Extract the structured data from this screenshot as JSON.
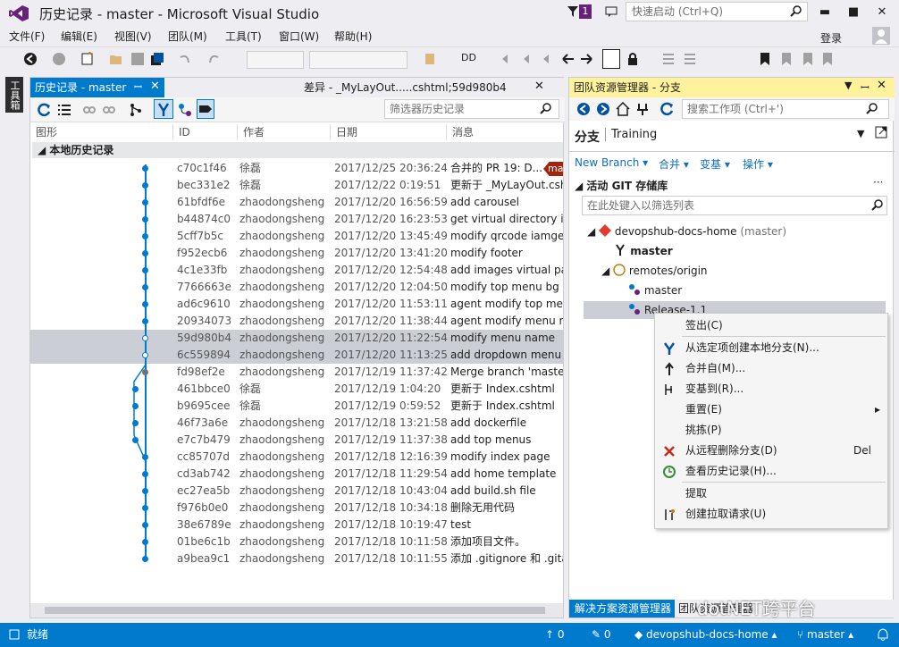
{
  "window": {
    "title": "历史记录 - master - Microsoft Visual Studio",
    "quick_launch": "快速启动 (Ctrl+Q)",
    "notif_count": "1",
    "login": "登录"
  },
  "menu": [
    "文件(F)",
    "编辑(E)",
    "视图(V)",
    "团队(M)",
    "工具(T)",
    "窗口(W)",
    "帮助(H)"
  ],
  "left_tab": "工具箱",
  "history": {
    "tab_label": "历史记录 - master",
    "diff_tab": "差异 - _MyLayOut.....cshtml;59d980b4",
    "filter_placeholder": "筛选器历史记录",
    "columns": [
      "图形",
      "ID",
      "作者",
      "日期",
      "消息"
    ],
    "group": "本地历史记录",
    "tag": "ma",
    "rows": [
      {
        "id": "c70c1f46",
        "author": "徐磊",
        "date": "2017/12/25 20:36:24",
        "msg": "合并的 PR 19: D..."
      },
      {
        "id": "bec331e2",
        "author": "徐磊",
        "date": "2017/12/22 0:19:51",
        "msg": "更新于 _MyLayOut.cshtml"
      },
      {
        "id": "61bfdf6e",
        "author": "zhaodongsheng",
        "date": "2017/12/20 16:56:59",
        "msg": "add carousel"
      },
      {
        "id": "b44874c0",
        "author": "zhaodongsheng",
        "date": "2017/12/20 16:23:53",
        "msg": "get virtual directory in"
      },
      {
        "id": "5cff7b5c",
        "author": "zhaodongsheng",
        "date": "2017/12/20 13:45:49",
        "msg": "modify qrcode iamge"
      },
      {
        "id": "f952ecb6",
        "author": "zhaodongsheng",
        "date": "2017/12/20 13:41:20",
        "msg": "modify footer"
      },
      {
        "id": "4c1e33fb",
        "author": "zhaodongsheng",
        "date": "2017/12/20 12:54:48",
        "msg": "add images virtual pa"
      },
      {
        "id": "7766663e",
        "author": "zhaodongsheng",
        "date": "2017/12/20 12:04:50",
        "msg": "modify top menu bg"
      },
      {
        "id": "ad6c9610",
        "author": "zhaodongsheng",
        "date": "2017/12/20 11:53:11",
        "msg": "agent modify top men"
      },
      {
        "id": "20934073",
        "author": "zhaodongsheng",
        "date": "2017/12/20 11:38:44",
        "msg": "agent modify menu n"
      },
      {
        "id": "59d980b4",
        "author": "zhaodongsheng",
        "date": "2017/12/20 11:22:54",
        "msg": "modify menu name"
      },
      {
        "id": "6c559894",
        "author": "zhaodongsheng",
        "date": "2017/12/20 11:13:25",
        "msg": "add dropdown menu"
      },
      {
        "id": "fd98ef2e",
        "author": "zhaodongsheng",
        "date": "2017/12/19 11:37:42",
        "msg": "Merge branch 'maste"
      },
      {
        "id": "461bbce0",
        "author": "徐磊",
        "date": "2017/12/19 1:04:20",
        "msg": "更新于 Index.cshtml"
      },
      {
        "id": "b9695cee",
        "author": "徐磊",
        "date": "2017/12/19 0:59:52",
        "msg": "更新于 Index.cshtml"
      },
      {
        "id": "46f73a6e",
        "author": "zhaodongsheng",
        "date": "2017/12/18 13:21:58",
        "msg": "add dockerfile"
      },
      {
        "id": "e7c7b479",
        "author": "zhaodongsheng",
        "date": "2017/12/19 11:37:38",
        "msg": "add top menus"
      },
      {
        "id": "cc85707d",
        "author": "zhaodongsheng",
        "date": "2017/12/18 12:16:39",
        "msg": "modify index page"
      },
      {
        "id": "cd3ab742",
        "author": "zhaodongsheng",
        "date": "2017/12/18 11:29:54",
        "msg": "add home template"
      },
      {
        "id": "ec27ea5b",
        "author": "zhaodongsheng",
        "date": "2017/12/18 10:43:04",
        "msg": "add build.sh file"
      },
      {
        "id": "f976b0e0",
        "author": "zhaodongsheng",
        "date": "2017/12/18 10:34:18",
        "msg": "删除无用代码"
      },
      {
        "id": "38e6789e",
        "author": "zhaodongsheng",
        "date": "2017/12/18 10:19:47",
        "msg": "test"
      },
      {
        "id": "01be6c1b",
        "author": "zhaodongsheng",
        "date": "2017/12/18 10:11:58",
        "msg": "添加项目文件。"
      },
      {
        "id": "a9bea9c1",
        "author": "zhaodongsheng",
        "date": "2017/12/18 10:11:55",
        "msg": "添加 .gitignore 和 .gita"
      }
    ]
  },
  "team": {
    "header": "团队资源管理器 - 分支",
    "search_placeholder": "搜索工作项 (Ctrl+')",
    "section": "分支",
    "project": "Training",
    "actions": [
      "New Branch",
      "合并",
      "变基",
      "操作"
    ],
    "repo_header": "活动 GIT 存储库",
    "filter_placeholder": "在此处键入以筛选列表",
    "repo_name": "devopshub-docs-home",
    "repo_branch": "(master)",
    "local_master": "master",
    "remote": "remotes/origin",
    "remote_master": "master",
    "remote_release": "Release-1.1",
    "bottom_tab1": "解决方案资源管理器",
    "bottom_tab2": "团队资源管理器"
  },
  "context_menu": [
    {
      "label": "签出(C)",
      "icon": ""
    },
    {
      "label": "从选定项创建本地分支(N)...",
      "icon": "branch-icon"
    },
    {
      "label": "合并自(M)...",
      "icon": "merge-icon"
    },
    {
      "label": "变基到(R)...",
      "icon": "rebase-icon"
    },
    {
      "label": "重置(E)",
      "icon": "",
      "submenu": true
    },
    {
      "label": "挑拣(P)",
      "icon": ""
    },
    {
      "label": "从远程删除分支(D)",
      "icon": "delete-icon",
      "shortcut": "Del"
    },
    {
      "label": "查看历史记录(H)...",
      "icon": "history-icon"
    },
    {
      "label": "提取",
      "icon": ""
    },
    {
      "label": "创建拉取请求(U)",
      "icon": "pull-request-icon"
    }
  ],
  "status": {
    "text": "就绪",
    "up": "0",
    "edits": "0",
    "repo": "devopshub-docs-home",
    "branch": "master"
  },
  "watermark": "dotNET跨平台",
  "colors": {
    "accent": "#007acc",
    "selected": "#ccced6",
    "header_yellow": "#fff29d"
  }
}
